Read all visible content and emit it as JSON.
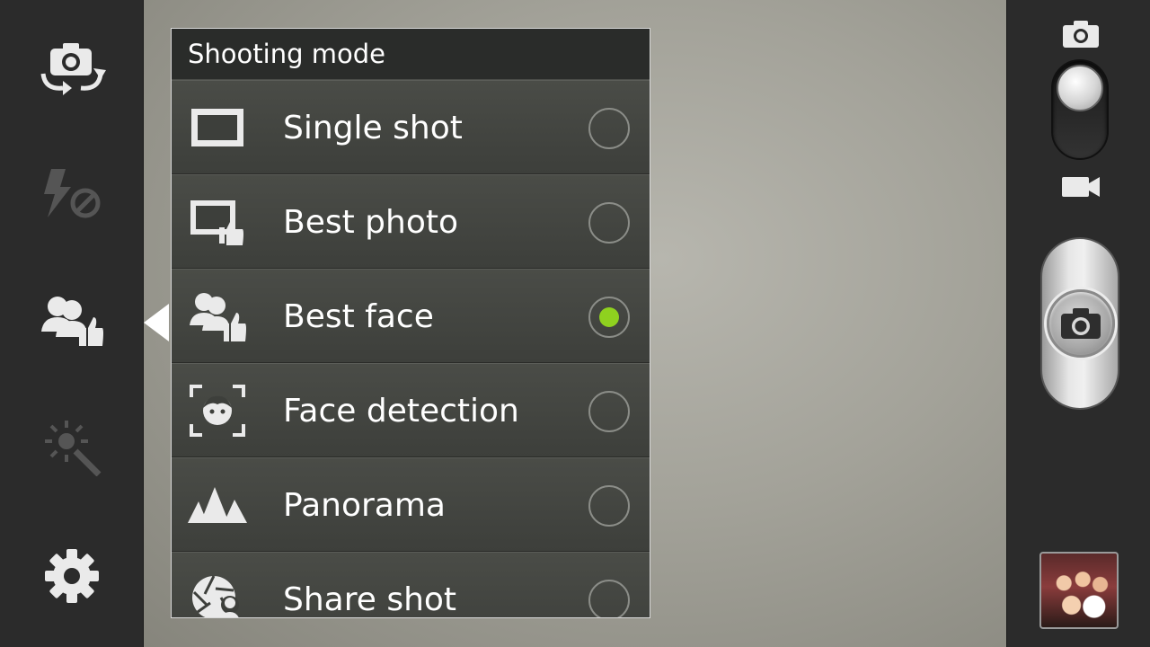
{
  "panel": {
    "title": "Shooting mode",
    "items": [
      {
        "label": "Single shot",
        "icon": "single-shot-icon",
        "selected": false
      },
      {
        "label": "Best photo",
        "icon": "best-photo-icon",
        "selected": false
      },
      {
        "label": "Best face",
        "icon": "best-face-icon",
        "selected": true
      },
      {
        "label": "Face detection",
        "icon": "face-detection-icon",
        "selected": false
      },
      {
        "label": "Panorama",
        "icon": "panorama-icon",
        "selected": false
      },
      {
        "label": "Share shot",
        "icon": "share-shot-icon",
        "selected": false
      }
    ]
  },
  "left_toolbar": [
    "switch-camera-icon",
    "flash-off-icon",
    "shooting-mode-icon",
    "effects-icon",
    "settings-icon"
  ],
  "right_toolbar": [
    "camera-mode-icon",
    "mode-toggle",
    "video-mode-icon",
    "shutter-button",
    "gallery-thumbnail"
  ],
  "colors": {
    "accent": "#8fd11f",
    "panel": "#3a3c38",
    "header": "#2a2c2a"
  }
}
